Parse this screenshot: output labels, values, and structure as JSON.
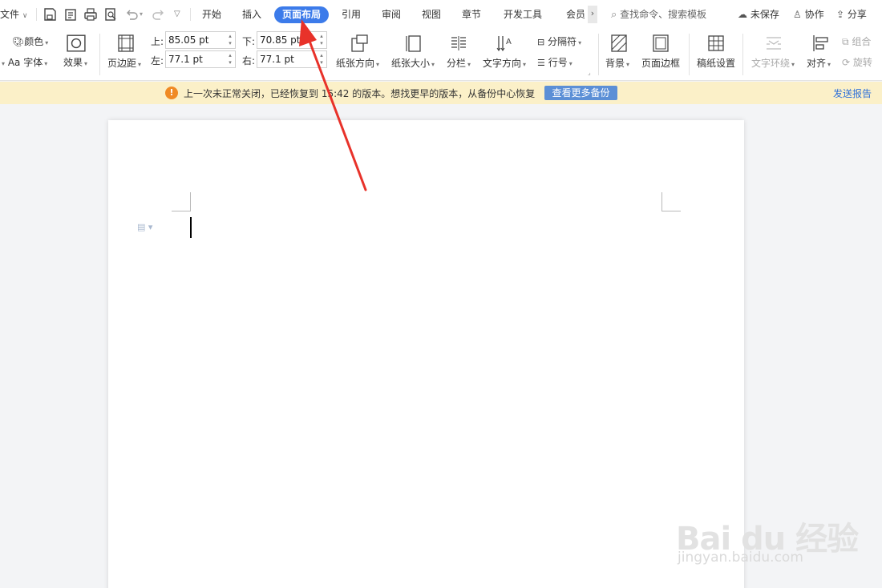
{
  "menubar": {
    "file_label": "文件",
    "tabs": [
      "开始",
      "插入",
      "页面布局",
      "引用",
      "审阅",
      "视图",
      "章节",
      "开发工具",
      "会员"
    ],
    "active_tab": "页面布局",
    "search_placeholder": "查找命令、搜索模板",
    "unsaved_label": "未保存",
    "collab_label": "协作",
    "share_label": "分享"
  },
  "ribbon": {
    "theme": {
      "color_label": "颜色",
      "font_label": "字体",
      "effect_label": "效果"
    },
    "margins": {
      "label": "页边距",
      "top_label": "上:",
      "top_value": "85.05 pt",
      "bottom_label": "下:",
      "bottom_value": "70.85 pt",
      "left_label": "左:",
      "left_value": "77.1 pt",
      "right_label": "右:",
      "right_value": "77.1 pt"
    },
    "orientation_label": "纸张方向",
    "size_label": "纸张大小",
    "columns_label": "分栏",
    "text_dir_label": "文字方向",
    "breaks_label": "分隔符",
    "line_num_label": "行号",
    "background_label": "背景",
    "border_label": "页面边框",
    "draft_label": "稿纸设置",
    "wrap_label": "文字环绕",
    "align_label": "对齐",
    "group_label": "组合",
    "rotate_label": "旋转"
  },
  "notification": {
    "message": "上一次未正常关闭，已经恢复到 15:42 的版本。想找更早的版本，从备份中心恢复",
    "button_label": "查看更多备份",
    "report_link": "发送报告"
  },
  "watermark": {
    "main": "Bai du 经验",
    "sub": "jingyan.baidu.com"
  },
  "colors": {
    "accent": "#3c7bea",
    "notify_bg": "#fbf0c8",
    "arrow": "#e8322a"
  }
}
